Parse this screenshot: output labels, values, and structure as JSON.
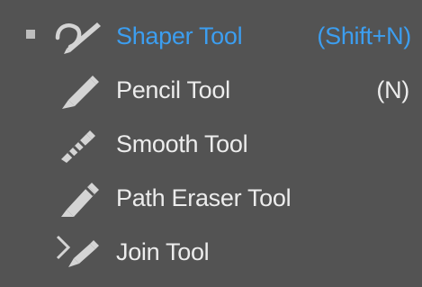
{
  "menu": {
    "items": [
      {
        "label": "Shaper Tool",
        "shortcut": "(Shift+N)",
        "icon": "shaper-icon",
        "active": true
      },
      {
        "label": "Pencil Tool",
        "shortcut": "(N)",
        "icon": "pencil-icon",
        "active": false
      },
      {
        "label": "Smooth Tool",
        "shortcut": "",
        "icon": "smooth-icon",
        "active": false
      },
      {
        "label": "Path Eraser Tool",
        "shortcut": "",
        "icon": "path-eraser-icon",
        "active": false
      },
      {
        "label": "Join Tool",
        "shortcut": "",
        "icon": "join-icon",
        "active": false
      }
    ]
  },
  "colors": {
    "background": "#535353",
    "text": "#ececec",
    "active_text": "#3c9ef0",
    "icon": "#d4d4d4"
  }
}
